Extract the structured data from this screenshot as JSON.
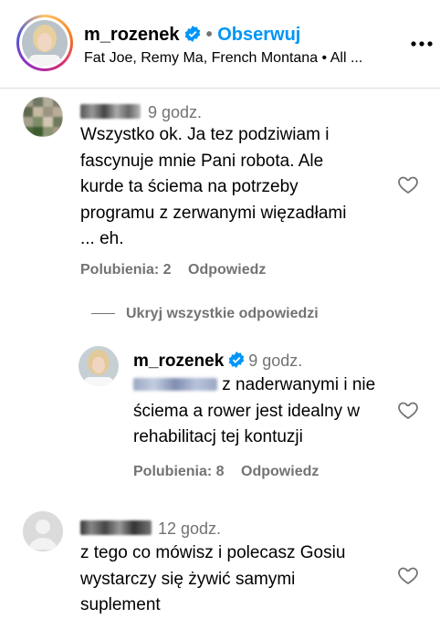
{
  "header": {
    "username": "m_rozenek",
    "separator": "•",
    "follow_label": "Obserwuj",
    "subtitle": "Fat Joe, Remy Ma, French Montana • All ..."
  },
  "comments": [
    {
      "time": "9 godz.",
      "text_lines": [
        "Wszystko ok. Ja tez podziwiam i",
        "fascynuje mnie Pani robota. Ale",
        "kurde ta ściema na potrzeby",
        "programu z zerwanymi więzadłami",
        "... eh."
      ],
      "likes_label": "Polubienia: 2",
      "reply_label": "Odpowiedz"
    }
  ],
  "hide_replies_label": "Ukryj wszystkie odpowiedzi",
  "reply": {
    "username": "m_rozenek",
    "time": "9 godz.",
    "text_first": " z naderwanymi i nie",
    "text_lines": [
      "ściema a rower jest idealny w",
      "rehabilitacj tej kontuzji"
    ],
    "likes_label": "Polubienia: 8",
    "reply_label": "Odpowiedz"
  },
  "comment2": {
    "time": "12 godz.",
    "text_lines": [
      "z tego co mówisz i polecasz Gosiu",
      "wystarczy się żywić samymi",
      "suplement"
    ]
  },
  "icons": [
    "verified-badge-icon",
    "more-options-icon",
    "heart-icon",
    "default-avatar-icon"
  ],
  "colors": {
    "link": "#0095f6",
    "muted": "#737373",
    "verified": "#0095f6"
  }
}
